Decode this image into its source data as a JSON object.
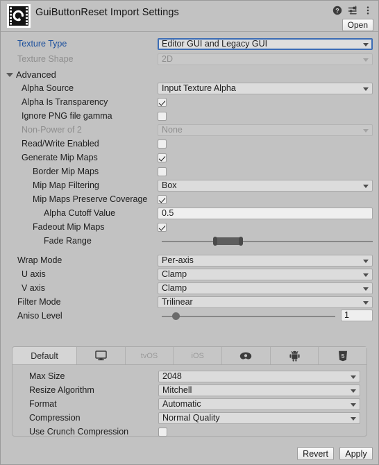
{
  "header": {
    "title": "GuiButtonReset Import Settings",
    "icon_name": "texture-asset-icon",
    "help_icon": "help-icon",
    "preset_icon": "preset-settings-icon",
    "menu_icon": "more-menu-icon",
    "open_label": "Open"
  },
  "top": {
    "texture_type_label": "Texture Type",
    "texture_type_value": "Editor GUI and Legacy GUI",
    "texture_shape_label": "Texture Shape",
    "texture_shape_value": "2D"
  },
  "advanced": {
    "section_label": "Advanced",
    "alpha_source_label": "Alpha Source",
    "alpha_source_value": "Input Texture Alpha",
    "alpha_is_transparency_label": "Alpha Is Transparency",
    "alpha_is_transparency_checked": true,
    "ignore_png_gamma_label": "Ignore PNG file gamma",
    "ignore_png_gamma_checked": false,
    "non_power_of_2_label": "Non-Power of 2",
    "non_power_of_2_value": "None",
    "read_write_label": "Read/Write Enabled",
    "read_write_checked": false,
    "generate_mip_maps_label": "Generate Mip Maps",
    "generate_mip_maps_checked": true,
    "border_mip_maps_label": "Border Mip Maps",
    "border_mip_maps_checked": false,
    "mip_map_filtering_label": "Mip Map Filtering",
    "mip_map_filtering_value": "Box",
    "mip_preserve_coverage_label": "Mip Maps Preserve Coverage",
    "mip_preserve_coverage_checked": true,
    "alpha_cutoff_label": "Alpha Cutoff Value",
    "alpha_cutoff_value": "0.5",
    "fadeout_mip_maps_label": "Fadeout Mip Maps",
    "fadeout_mip_maps_checked": true,
    "fade_range_label": "Fade Range",
    "fade_range_start_pct": 26,
    "fade_range_end_pct": 37
  },
  "wrap": {
    "wrap_mode_label": "Wrap Mode",
    "wrap_mode_value": "Per-axis",
    "u_axis_label": "U axis",
    "u_axis_value": "Clamp",
    "v_axis_label": "V axis",
    "v_axis_value": "Clamp",
    "filter_mode_label": "Filter Mode",
    "filter_mode_value": "Trilinear",
    "aniso_level_label": "Aniso Level",
    "aniso_level_value": "1",
    "aniso_level_pct": 8
  },
  "platform_tabs": [
    {
      "label": "Default",
      "icon": "none",
      "active": true,
      "dim": false
    },
    {
      "label": "",
      "icon": "monitor-icon",
      "active": false,
      "dim": false
    },
    {
      "label": "tvOS",
      "icon": "none",
      "active": false,
      "dim": true
    },
    {
      "label": "iOS",
      "icon": "none",
      "active": false,
      "dim": true
    },
    {
      "label": "",
      "icon": "visionos-icon",
      "active": false,
      "dim": false
    },
    {
      "label": "",
      "icon": "android-icon",
      "active": false,
      "dim": false
    },
    {
      "label": "",
      "icon": "webgl-html5-icon",
      "active": false,
      "dim": false
    }
  ],
  "platform_settings": {
    "max_size_label": "Max Size",
    "max_size_value": "2048",
    "resize_algorithm_label": "Resize Algorithm",
    "resize_algorithm_value": "Mitchell",
    "format_label": "Format",
    "format_value": "Automatic",
    "compression_label": "Compression",
    "compression_value": "Normal Quality",
    "crunch_label": "Use Crunch Compression",
    "crunch_checked": false
  },
  "footer": {
    "revert_label": "Revert",
    "apply_label": "Apply"
  },
  "colors": {
    "panel_bg": "#c2c2c2",
    "field_bg": "#dcdcdc",
    "input_bg": "#efefef",
    "accent_blue": "#1b4f9c",
    "focus_border": "#3b6cb5",
    "disabled_text": "#8e8e8e"
  }
}
